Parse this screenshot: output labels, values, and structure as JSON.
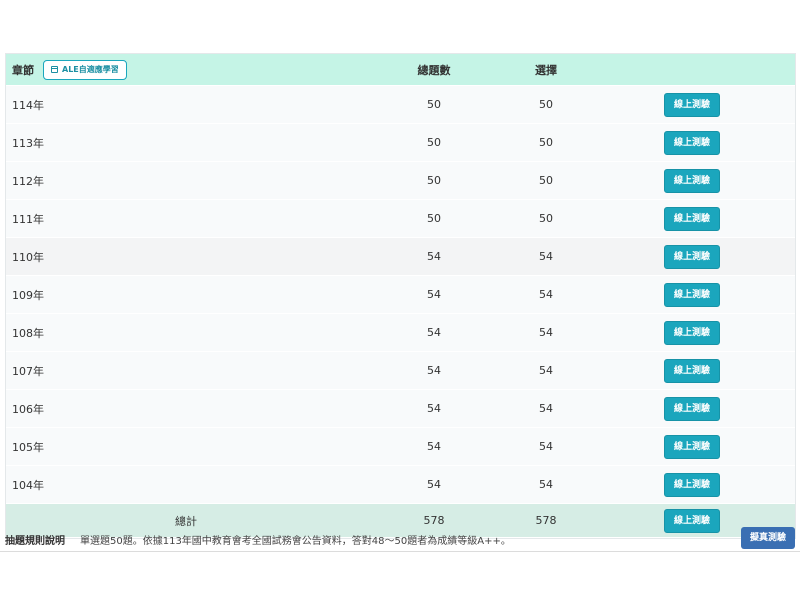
{
  "table": {
    "headers": {
      "chapter": "章節",
      "ale_button": "ALE自適應學習",
      "total": "總題數",
      "choice": "選擇"
    },
    "rows": [
      {
        "name": "114年",
        "total": "50",
        "choice": "50",
        "action": "線上測驗"
      },
      {
        "name": "113年",
        "total": "50",
        "choice": "50",
        "action": "線上測驗"
      },
      {
        "name": "112年",
        "total": "50",
        "choice": "50",
        "action": "線上測驗"
      },
      {
        "name": "111年",
        "total": "50",
        "choice": "50",
        "action": "線上測驗"
      },
      {
        "name": "110年",
        "total": "54",
        "choice": "54",
        "action": "線上測驗"
      },
      {
        "name": "109年",
        "total": "54",
        "choice": "54",
        "action": "線上測驗"
      },
      {
        "name": "108年",
        "total": "54",
        "choice": "54",
        "action": "線上測驗"
      },
      {
        "name": "107年",
        "total": "54",
        "choice": "54",
        "action": "線上測驗"
      },
      {
        "name": "106年",
        "total": "54",
        "choice": "54",
        "action": "線上測驗"
      },
      {
        "name": "105年",
        "total": "54",
        "choice": "54",
        "action": "線上測驗"
      },
      {
        "name": "104年",
        "total": "54",
        "choice": "54",
        "action": "線上測驗"
      }
    ],
    "summary": {
      "label": "總計",
      "total": "578",
      "choice": "578",
      "action": "線上測驗"
    }
  },
  "footer": {
    "rules_title": "抽題規則說明",
    "rules_text": "單選題50題。依據113年國中教育會考全國試務會公告資料，答對48～50題者為成績等級A++。",
    "simulate_button": "擬真測驗"
  },
  "colors": {
    "header_bg": "#c5f4e6",
    "button_bg": "#1ba6bd",
    "summary_bg": "#d6ede5",
    "simulate_bg": "#3a6fb3"
  },
  "icons": {
    "ale_button_icon": "calendar-icon"
  }
}
